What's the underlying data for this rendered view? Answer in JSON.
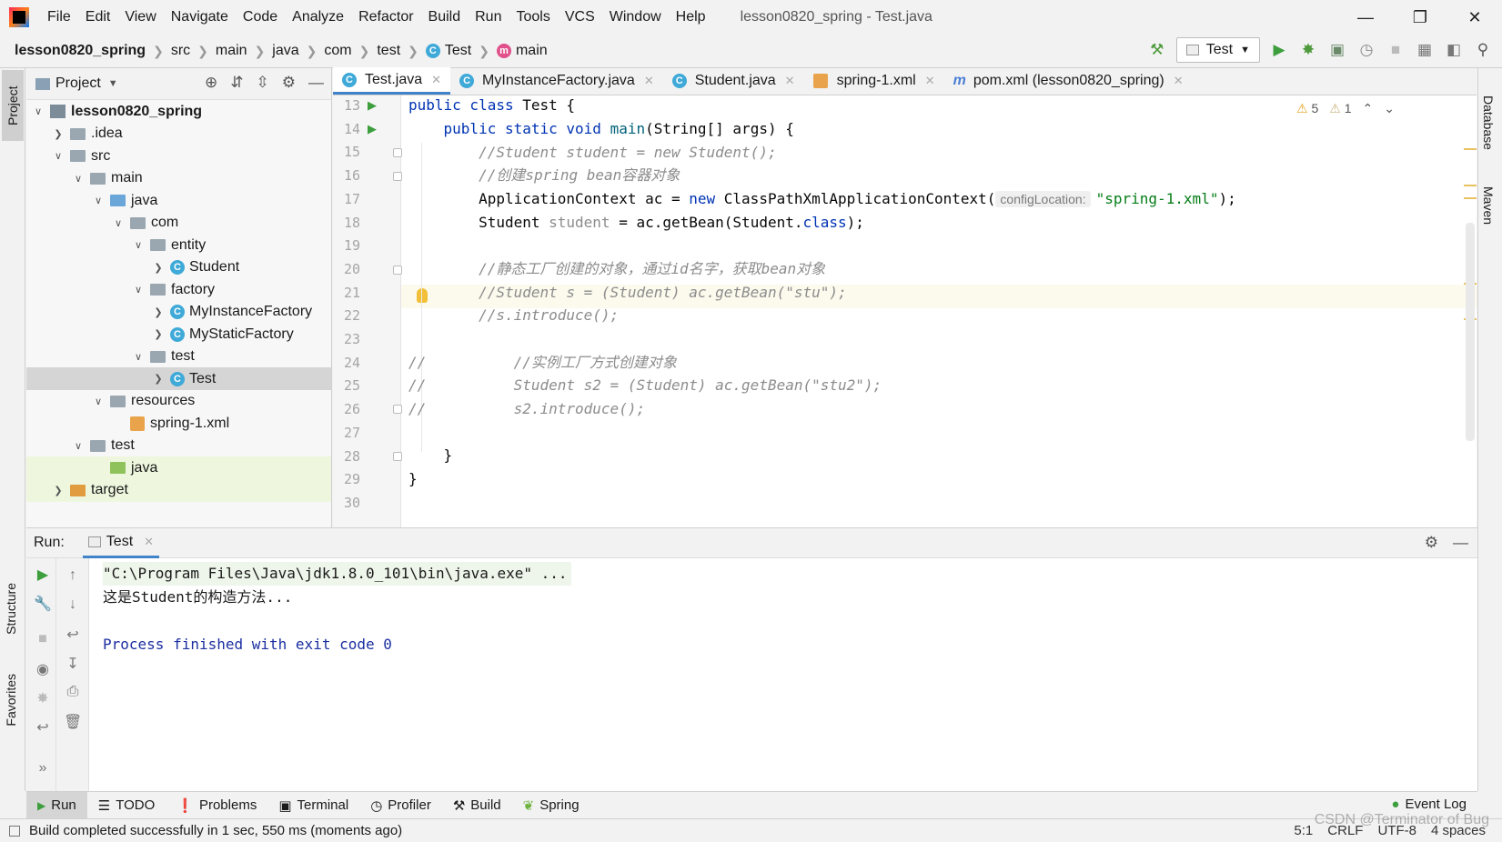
{
  "menubar": {
    "items": [
      "File",
      "Edit",
      "View",
      "Navigate",
      "Code",
      "Analyze",
      "Refactor",
      "Build",
      "Run",
      "Tools",
      "VCS",
      "Window",
      "Help"
    ],
    "window_title": "lesson0820_spring - Test.java"
  },
  "navbar": {
    "crumbs": [
      "lesson0820_spring",
      "src",
      "main",
      "java",
      "com",
      "test",
      "Test",
      "main"
    ],
    "run_config": "Test"
  },
  "left_stripe": {
    "project": "Project",
    "structure": "Structure",
    "favorites": "Favorites"
  },
  "right_stripe": {
    "database": "Database",
    "maven": "Maven"
  },
  "project_panel": {
    "title": "Project",
    "tree": [
      {
        "label": "lesson0820_spring",
        "depth": 0,
        "arrow": "v",
        "icon": "project",
        "bold": true
      },
      {
        "label": ".idea",
        "depth": 1,
        "arrow": ">",
        "icon": "folder"
      },
      {
        "label": "src",
        "depth": 1,
        "arrow": "v",
        "icon": "folder"
      },
      {
        "label": "main",
        "depth": 2,
        "arrow": "v",
        "icon": "folder"
      },
      {
        "label": "java",
        "depth": 3,
        "arrow": "v",
        "icon": "folder-blue"
      },
      {
        "label": "com",
        "depth": 4,
        "arrow": "v",
        "icon": "folder"
      },
      {
        "label": "entity",
        "depth": 5,
        "arrow": "v",
        "icon": "folder"
      },
      {
        "label": "Student",
        "depth": 6,
        "arrow": ">",
        "icon": "class"
      },
      {
        "label": "factory",
        "depth": 5,
        "arrow": "v",
        "icon": "folder"
      },
      {
        "label": "MyInstanceFactory",
        "depth": 6,
        "arrow": ">",
        "icon": "class"
      },
      {
        "label": "MyStaticFactory",
        "depth": 6,
        "arrow": ">",
        "icon": "class"
      },
      {
        "label": "test",
        "depth": 5,
        "arrow": "v",
        "icon": "folder"
      },
      {
        "label": "Test",
        "depth": 6,
        "arrow": ">",
        "icon": "class",
        "selected": true
      },
      {
        "label": "resources",
        "depth": 3,
        "arrow": "v",
        "icon": "folder-res"
      },
      {
        "label": "spring-1.xml",
        "depth": 4,
        "arrow": "",
        "icon": "xml"
      },
      {
        "label": "test",
        "depth": 2,
        "arrow": "v",
        "icon": "folder"
      },
      {
        "label": "java",
        "depth": 3,
        "arrow": "",
        "icon": "folder-green",
        "green": true
      },
      {
        "label": "target",
        "depth": 1,
        "arrow": ">",
        "icon": "folder-orange",
        "green": true
      }
    ]
  },
  "editor_tabs": [
    {
      "label": "Test.java",
      "icon": "class",
      "active": true
    },
    {
      "label": "MyInstanceFactory.java",
      "icon": "class"
    },
    {
      "label": "Student.java",
      "icon": "class"
    },
    {
      "label": "spring-1.xml",
      "icon": "xml"
    },
    {
      "label": "pom.xml (lesson0820_spring)",
      "icon": "maven"
    }
  ],
  "editor": {
    "warnings": {
      "warn_count": "5",
      "weak_count": "1"
    },
    "line_numbers": [
      "13",
      "14",
      "15",
      "16",
      "17",
      "18",
      "19",
      "20",
      "21",
      "22",
      "23",
      "24",
      "25",
      "26",
      "27",
      "28",
      "29",
      "30"
    ],
    "lines": {
      "l13_kw": "public class ",
      "l13_rest": "Test {",
      "l14_kw": "    public static void ",
      "l14_m": "main",
      "l14_rest": "(String[] args) {",
      "l15": "        //Student student = new Student();",
      "l16": "        //创建spring bean容器对象",
      "l17_a": "        ApplicationContext ac = ",
      "l17_kw": "new ",
      "l17_b": "ClassPathXmlApplicationContext(",
      "l17_hint": "configLocation:",
      "l17_str": "\"spring-1.xml\"",
      "l17_end": ");",
      "l18_a": "        Student ",
      "l18_v": "student",
      "l18_b": " = ac.getBean(Student.",
      "l18_kw": "class",
      "l18_end": ");",
      "l20": "        //静态工厂创建的对象，通过id名字，获取bean对象",
      "l21": "        //Student s = (Student) ac.getBean(\"stu\");",
      "l22": "        //s.introduce();",
      "l24": "//          //实例工厂方式创建对象",
      "l25": "//          Student s2 = (Student) ac.getBean(\"stu2\");",
      "l26": "//          s2.introduce();",
      "l28": "    }",
      "l29": "}"
    }
  },
  "run_panel": {
    "label": "Run:",
    "tab": "Test",
    "console": [
      "\"C:\\Program Files\\Java\\jdk1.8.0_101\\bin\\java.exe\" ...",
      "这是Student的构造方法...",
      "",
      "Process finished with exit code 0"
    ]
  },
  "bottom_tabs": [
    "Run",
    "TODO",
    "Problems",
    "Terminal",
    "Profiler",
    "Build",
    "Spring"
  ],
  "event_log": "Event Log",
  "statusbar": {
    "message": "Build completed successfully in 1 sec, 550 ms (moments ago)",
    "position": "5:1",
    "line_sep": "CRLF",
    "encoding": "UTF-8",
    "indent": "4 spaces"
  },
  "watermark": "CSDN @Terminator of Bug",
  "colors": {
    "keyword": "#0033b3",
    "comment": "#8c8c8c",
    "string": "#067d17",
    "accent": "#4083c9",
    "run_green": "#3c9e3c"
  }
}
